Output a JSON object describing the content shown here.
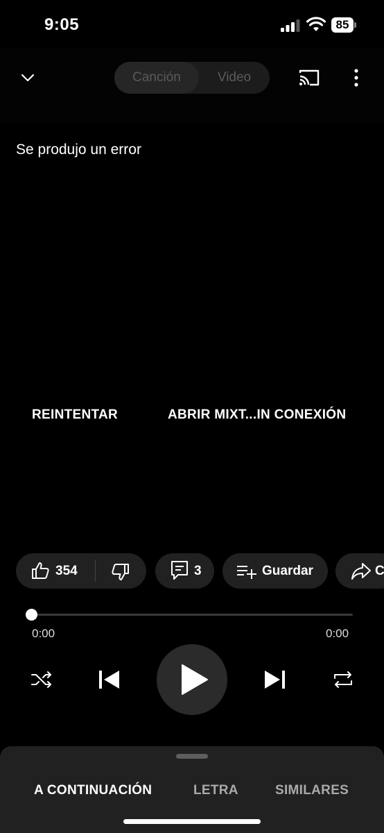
{
  "status_bar": {
    "time": "9:05",
    "battery": "85"
  },
  "header": {
    "toggle": {
      "song_label": "Canción",
      "video_label": "Video"
    }
  },
  "player": {
    "error_message": "Se produjo un error",
    "retry_label": "REINTENTAR",
    "open_mix_label": "ABRIR MIXT...IN CONEXIÓN"
  },
  "actions": {
    "likes": "354",
    "comments": "3",
    "save_label": "Guardar",
    "share_label": "C"
  },
  "progress": {
    "current": "0:00",
    "duration": "0:00",
    "fraction": 0.0
  },
  "controls": {
    "shuffle": "shuffle-icon",
    "previous": "skip-previous-icon",
    "play": "play-icon",
    "next": "skip-next-icon",
    "repeat": "repeat-icon"
  },
  "tabs": [
    {
      "label": "A CONTINUACIÓN",
      "active": true
    },
    {
      "label": "LETRA",
      "active": false
    },
    {
      "label": "SIMILARES",
      "active": false
    }
  ]
}
